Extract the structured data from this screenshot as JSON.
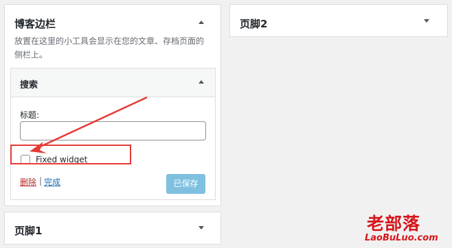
{
  "blog_sidebar": {
    "title": "博客边栏",
    "description_line1": "放置在这里的小工具会显示在您的文章、存档页面的",
    "description_line2": "侧栏上。"
  },
  "search_widget": {
    "title": "搜索",
    "field_label": "标题:",
    "title_value": "",
    "fixed_widget_label": "Fixed widget",
    "fixed_widget_checked": false,
    "delete_link": "删除",
    "separator": "|",
    "done_link": "完成",
    "save_button": "已保存"
  },
  "footer1": {
    "title": "页脚1"
  },
  "footer2": {
    "title": "页脚2"
  },
  "watermark": {
    "line1": "老部落",
    "line2": "LaoBuLuo.com"
  },
  "colors": {
    "link_red": "#b32d2e",
    "link_blue": "#2271b1",
    "highlight": "#e53935",
    "button_disabled": "#7fc0e0"
  }
}
